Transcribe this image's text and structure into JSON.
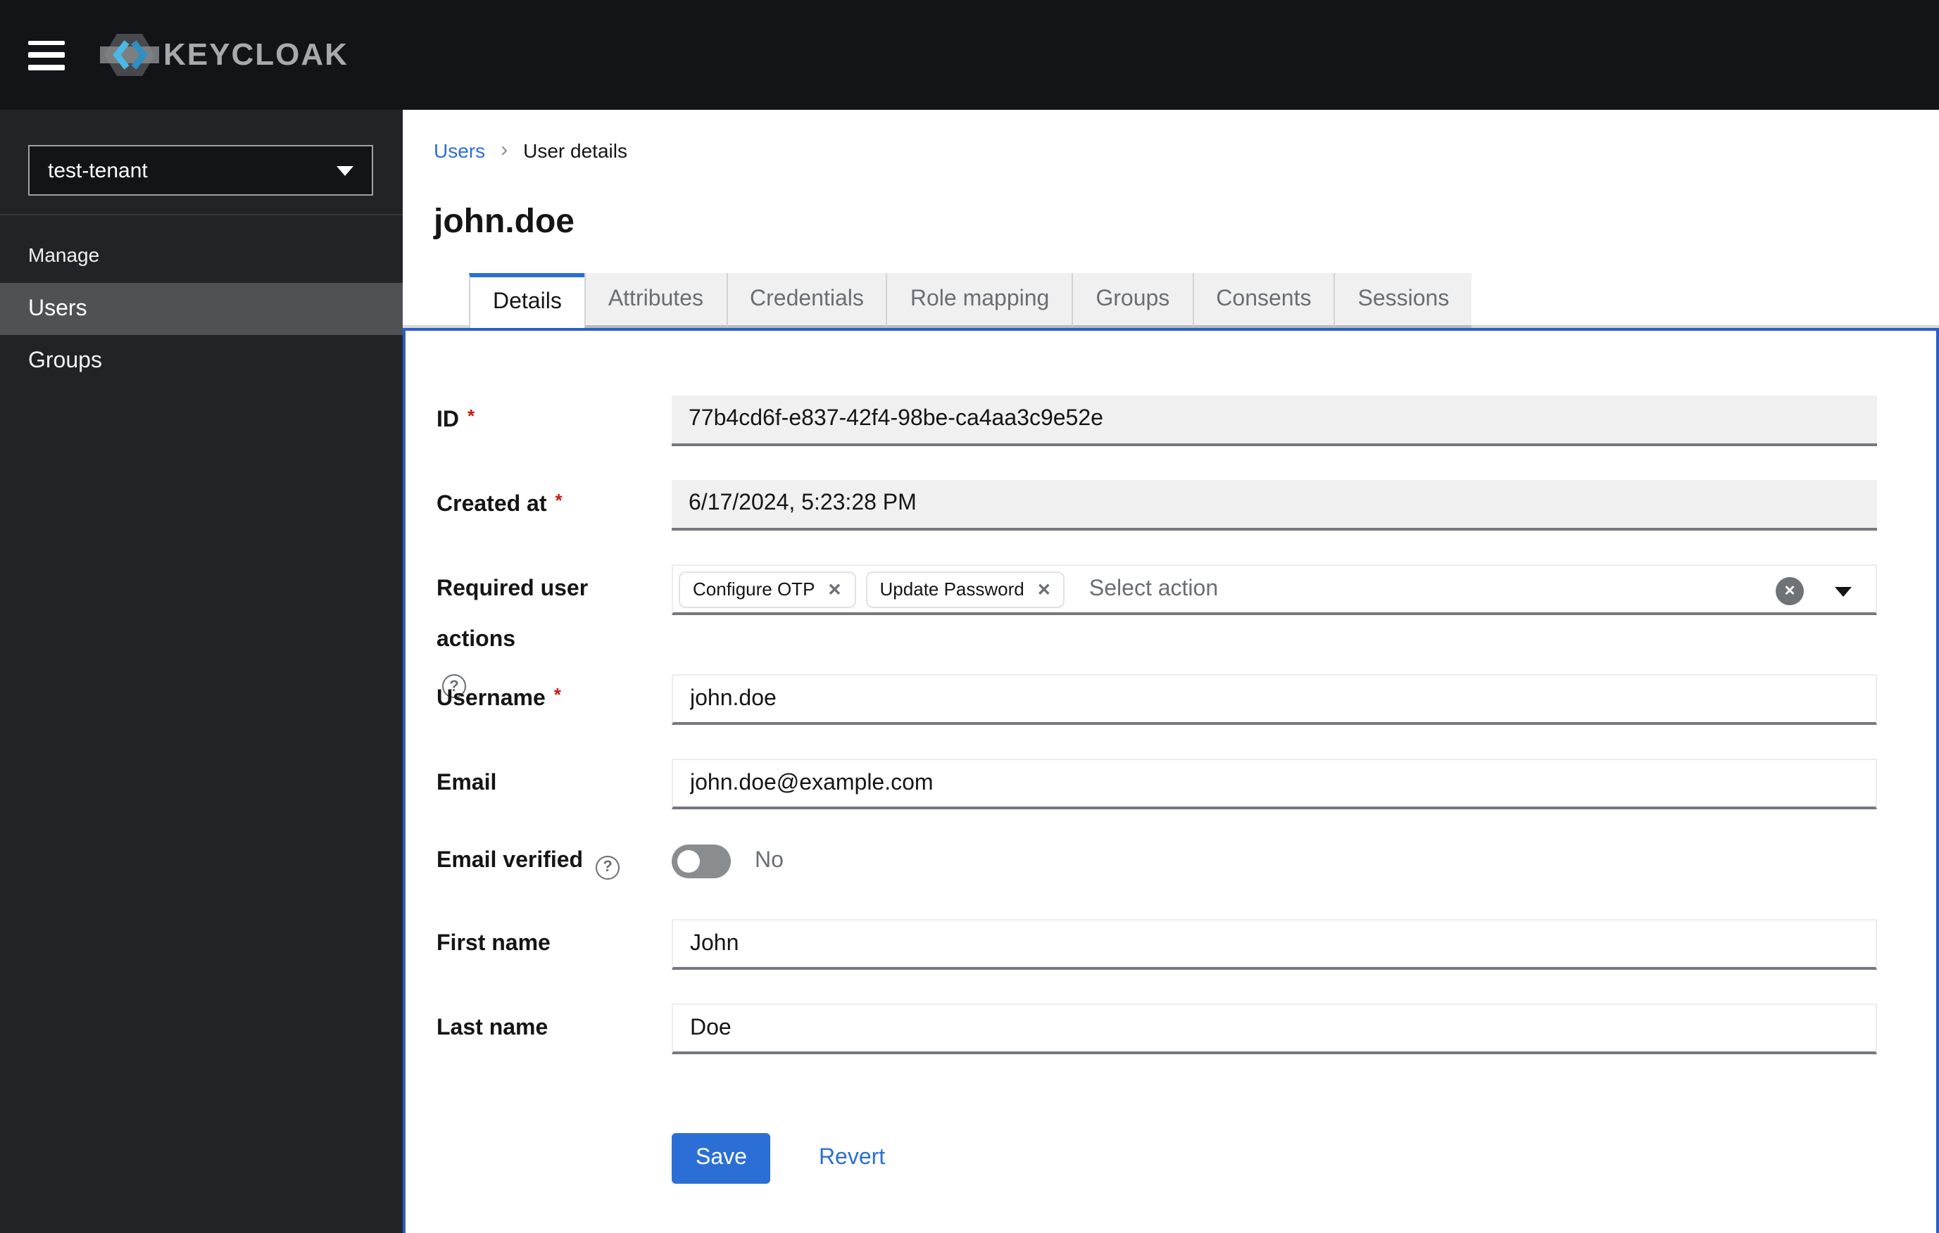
{
  "masthead": {
    "brand": "KEYCLOAK"
  },
  "sidebar": {
    "realm_selector": {
      "value": "test-tenant"
    },
    "section_title": "Manage",
    "nav": [
      {
        "label": "Users",
        "active": true
      },
      {
        "label": "Groups",
        "active": false
      }
    ]
  },
  "breadcrumb": {
    "parent": "Users",
    "separator": "›",
    "current": "User details"
  },
  "page_title": "john.doe",
  "tabs": [
    {
      "label": "Details",
      "active": true
    },
    {
      "label": "Attributes",
      "active": false
    },
    {
      "label": "Credentials",
      "active": false
    },
    {
      "label": "Role mapping",
      "active": false
    },
    {
      "label": "Groups",
      "active": false
    },
    {
      "label": "Consents",
      "active": false
    },
    {
      "label": "Sessions",
      "active": false
    }
  ],
  "form": {
    "id": {
      "label": "ID",
      "required_marker": "*",
      "value": "77b4cd6f-e837-42f4-98be-ca4aa3c9e52e",
      "disabled": true
    },
    "created_at": {
      "label": "Created at",
      "required_marker": "*",
      "value": "6/17/2024, 5:23:28 PM",
      "disabled": true
    },
    "required_user_actions": {
      "label": "Required user actions",
      "chips": [
        {
          "label": "Configure OTP"
        },
        {
          "label": "Update Password"
        }
      ],
      "placeholder": "Select action"
    },
    "username": {
      "label": "Username",
      "required_marker": "*",
      "value": "john.doe"
    },
    "email": {
      "label": "Email",
      "value": "john.doe@example.com"
    },
    "email_verified": {
      "label": "Email verified",
      "state_label": "No",
      "enabled": false
    },
    "first_name": {
      "label": "First name",
      "value": "John"
    },
    "last_name": {
      "label": "Last name",
      "value": "Doe"
    }
  },
  "actions": {
    "save": "Save",
    "revert": "Revert"
  },
  "icons": {
    "close": "✕",
    "clear_all": "✕",
    "help": "?"
  },
  "colors": {
    "accent_blue": "#2b6fd6",
    "panel_outline_blue": "#2b5dc8",
    "danger_red": "#c9190b",
    "masthead_bg": "#131417",
    "sidebar_bg": "#212427",
    "sidebar_active_bg": "#4f5255",
    "tab_inactive_bg": "#f0f0f0",
    "input_disabled_bg": "#f0f0f0",
    "toggle_off_bg": "#8a8d90"
  }
}
